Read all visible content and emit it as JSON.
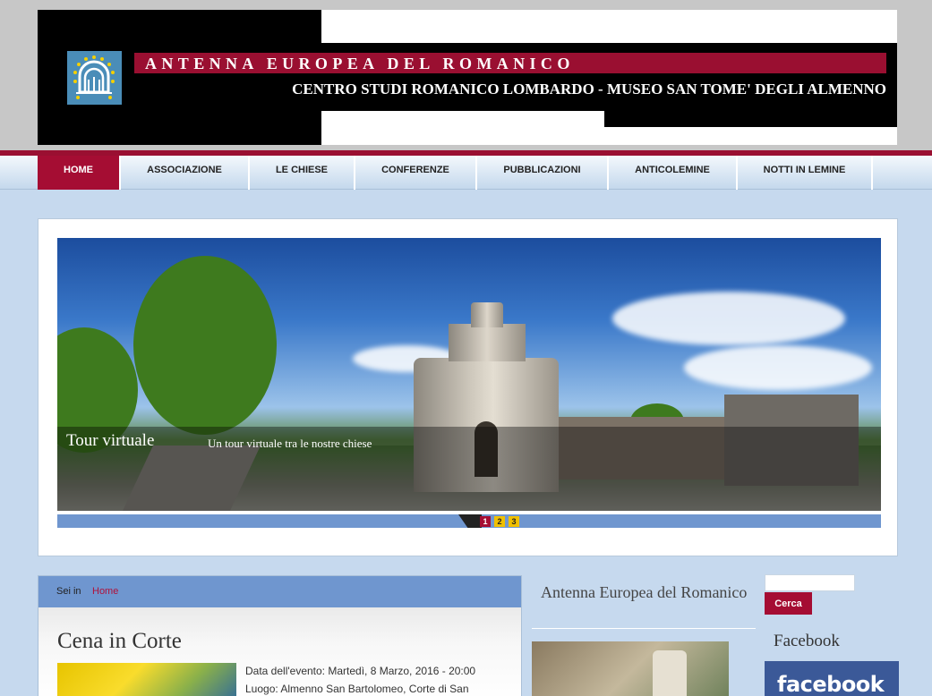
{
  "header": {
    "title": "ANTENNA   EUROPEA   DEL   ROMANICO",
    "subtitle": "CENTRO STUDI ROMANICO LOMBARDO - MUSEO SAN TOME' DEGLI ALMENNO",
    "logo_icon": "stars-arch-logo"
  },
  "nav": {
    "items": [
      {
        "label": "HOME",
        "active": true
      },
      {
        "label": "ASSOCIAZIONE"
      },
      {
        "label": "LE CHIESE"
      },
      {
        "label": "CONFERENZE"
      },
      {
        "label": "PUBBLICAZIONI"
      },
      {
        "label": "ANTICOLEMINE"
      },
      {
        "label": "NOTTI IN LEMINE"
      }
    ]
  },
  "slider": {
    "caption_title": "Tour virtuale",
    "caption_text": "Un tour virtuale tra le nostre chiese",
    "pages": [
      "1",
      "2",
      "3"
    ],
    "active_page": 1
  },
  "breadcrumb": {
    "label": "Sei in",
    "link": "Home"
  },
  "article": {
    "title": "Cena in Corte",
    "meta_line1": "Data dell'evento: Martedì, 8 Marzo, 2016 - 20:00",
    "meta_line2": "Luogo: Almenno San Bartolomeo, Corte di San"
  },
  "middle": {
    "title": "Antenna Europea del Romanico"
  },
  "sidebar": {
    "search_button": "Cerca",
    "facebook_title": "Facebook",
    "facebook_logo": "facebook"
  },
  "colors": {
    "accent": "#a50d33",
    "nav_bg": "#d7e5f3",
    "page_bg": "#c6d9ee",
    "strip": "#6f96cf"
  }
}
